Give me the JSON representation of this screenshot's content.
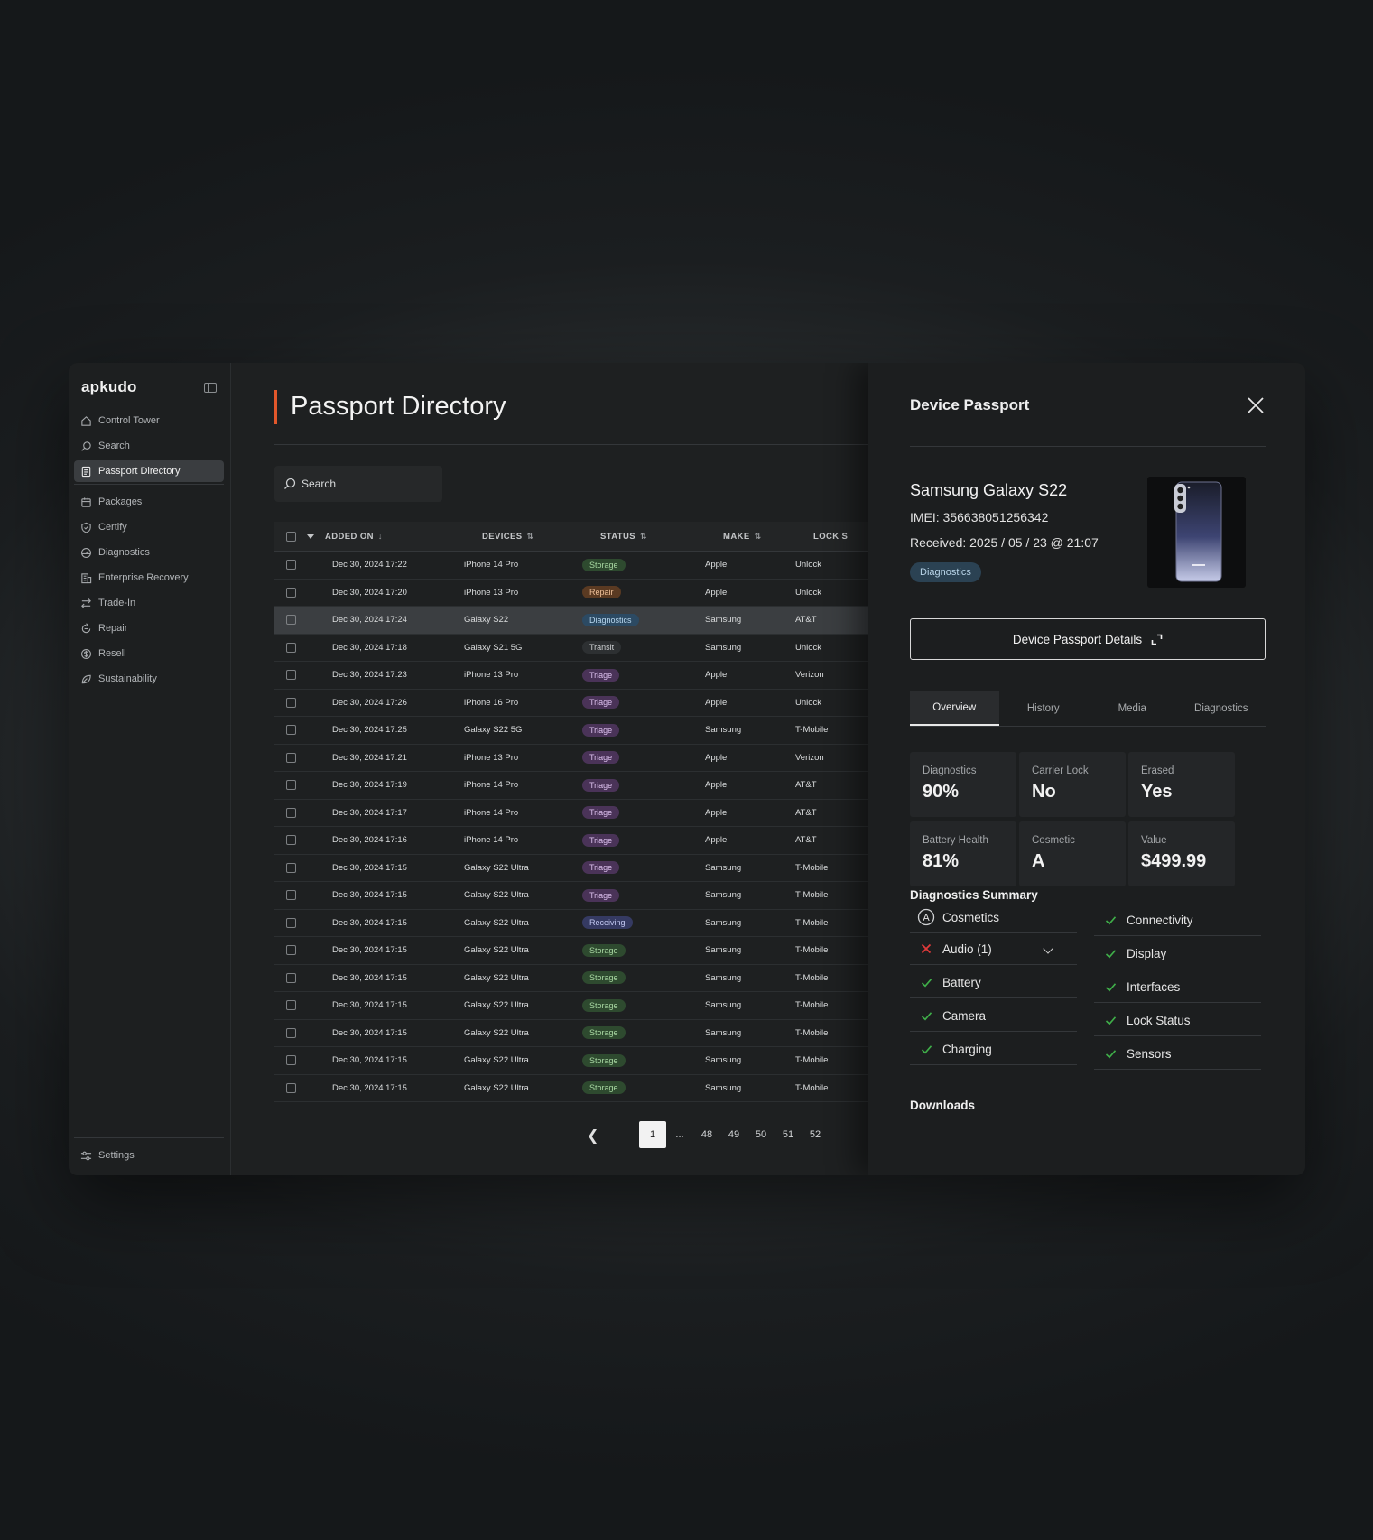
{
  "app": {
    "logo": "apkudo"
  },
  "sidebar": {
    "items": [
      {
        "label": "Control Tower",
        "icon": "home-icon"
      },
      {
        "label": "Search",
        "icon": "search-icon"
      },
      {
        "label": "Passport Directory",
        "icon": "document-icon",
        "active": true
      },
      {
        "label": "Packages",
        "icon": "package-icon"
      },
      {
        "label": "Certify",
        "icon": "shield-check-icon"
      },
      {
        "label": "Diagnostics",
        "icon": "gauge-icon"
      },
      {
        "label": "Enterprise Recovery",
        "icon": "building-icon"
      },
      {
        "label": "Trade-In",
        "icon": "swap-icon"
      },
      {
        "label": "Repair",
        "icon": "repair-icon"
      },
      {
        "label": "Resell",
        "icon": "dollar-circle-icon"
      },
      {
        "label": "Sustainability",
        "icon": "leaf-icon"
      }
    ],
    "settings_label": "Settings"
  },
  "main": {
    "title": "Passport Directory",
    "search_label": "Search",
    "table": {
      "headers": {
        "added_on": "ADDED ON",
        "devices": "DEVICES",
        "status": "STATUS",
        "make": "MAKE",
        "lock": "LOCK S"
      },
      "rows": [
        {
          "date": "Dec 30, 2024 17:22",
          "device": "iPhone 14 Pro",
          "status": "Storage",
          "make": "Apple",
          "lock": "Unlock"
        },
        {
          "date": "Dec 30, 2024 17:20",
          "device": "iPhone 13 Pro",
          "status": "Repair",
          "make": "Apple",
          "lock": "Unlock"
        },
        {
          "date": "Dec 30, 2024 17:24",
          "device": "Galaxy S22",
          "status": "Diagnostics",
          "make": "Samsung",
          "lock": "AT&T",
          "selected": true
        },
        {
          "date": "Dec 30, 2024 17:18",
          "device": "Galaxy S21 5G",
          "status": "Transit",
          "make": "Samsung",
          "lock": "Unlock"
        },
        {
          "date": "Dec 30, 2024 17:23",
          "device": "iPhone 13 Pro",
          "status": "Triage",
          "make": "Apple",
          "lock": "Verizon"
        },
        {
          "date": "Dec 30, 2024 17:26",
          "device": "iPhone 16 Pro",
          "status": "Triage",
          "make": "Apple",
          "lock": "Unlock"
        },
        {
          "date": "Dec 30, 2024 17:25",
          "device": "Galaxy S22 5G",
          "status": "Triage",
          "make": "Samsung",
          "lock": "T-Mobile"
        },
        {
          "date": "Dec 30, 2024 17:21",
          "device": "iPhone 13 Pro",
          "status": "Triage",
          "make": "Apple",
          "lock": "Verizon"
        },
        {
          "date": "Dec 30, 2024 17:19",
          "device": "iPhone 14 Pro",
          "status": "Triage",
          "make": "Apple",
          "lock": "AT&T"
        },
        {
          "date": "Dec 30, 2024 17:17",
          "device": "iPhone 14 Pro",
          "status": "Triage",
          "make": "Apple",
          "lock": "AT&T"
        },
        {
          "date": "Dec 30, 2024 17:16",
          "device": "iPhone 14 Pro",
          "status": "Triage",
          "make": "Apple",
          "lock": "AT&T"
        },
        {
          "date": "Dec 30, 2024 17:15",
          "device": "Galaxy S22 Ultra",
          "status": "Triage",
          "make": "Samsung",
          "lock": "T-Mobile"
        },
        {
          "date": "Dec 30, 2024 17:15",
          "device": "Galaxy S22 Ultra",
          "status": "Triage",
          "make": "Samsung",
          "lock": "T-Mobile"
        },
        {
          "date": "Dec 30, 2024 17:15",
          "device": "Galaxy S22 Ultra",
          "status": "Receiving",
          "make": "Samsung",
          "lock": "T-Mobile"
        },
        {
          "date": "Dec 30, 2024 17:15",
          "device": "Galaxy S22 Ultra",
          "status": "Storage",
          "make": "Samsung",
          "lock": "T-Mobile"
        },
        {
          "date": "Dec 30, 2024 17:15",
          "device": "Galaxy S22 Ultra",
          "status": "Storage",
          "make": "Samsung",
          "lock": "T-Mobile"
        },
        {
          "date": "Dec 30, 2024 17:15",
          "device": "Galaxy S22 Ultra",
          "status": "Storage",
          "make": "Samsung",
          "lock": "T-Mobile"
        },
        {
          "date": "Dec 30, 2024 17:15",
          "device": "Galaxy S22 Ultra",
          "status": "Storage",
          "make": "Samsung",
          "lock": "T-Mobile"
        },
        {
          "date": "Dec 30, 2024 17:15",
          "device": "Galaxy S22 Ultra",
          "status": "Storage",
          "make": "Samsung",
          "lock": "T-Mobile"
        },
        {
          "date": "Dec 30, 2024 17:15",
          "device": "Galaxy S22 Ultra",
          "status": "Storage",
          "make": "Samsung",
          "lock": "T-Mobile"
        }
      ]
    },
    "status_colors": {
      "Storage": {
        "bg": "#2e4a2f",
        "fg": "#a9d9a3"
      },
      "Repair": {
        "bg": "#5a3a22",
        "fg": "#f0c29a"
      },
      "Diagnostics": {
        "bg": "#2c4a63",
        "fg": "#b9d8f0"
      },
      "Transit": {
        "bg": "#2d3032",
        "fg": "#d0d2d4"
      },
      "Triage": {
        "bg": "#4a3358",
        "fg": "#dcc0ee"
      },
      "Receiving": {
        "bg": "#353a62",
        "fg": "#c3c9f2"
      }
    },
    "pagination": {
      "pages": [
        "1",
        "...",
        "48",
        "49",
        "50",
        "51",
        "52"
      ],
      "current": "1"
    }
  },
  "panel": {
    "title": "Device Passport",
    "device_name": "Samsung Galaxy S22",
    "imei": "IMEI: 356638051256342",
    "received": "Received: 2025 / 05 / 23 @ 21:07",
    "status_badge": "Diagnostics",
    "details_button": "Device Passport Details",
    "tabs": [
      "Overview",
      "History",
      "Media",
      "Diagnostics"
    ],
    "active_tab": "Overview",
    "stats": [
      {
        "label": "Diagnostics",
        "value": "90%"
      },
      {
        "label": "Carrier Lock",
        "value": "No"
      },
      {
        "label": "Erased",
        "value": "Yes"
      },
      {
        "label": "Battery Health",
        "value": "81%"
      },
      {
        "label": "Cosmetic",
        "value": "A"
      },
      {
        "label": "Value",
        "value": "$499.99"
      }
    ],
    "diagnostics_summary_title": "Diagnostics Summary",
    "diagnostics_left": [
      {
        "label": "Cosmetics",
        "state": "grade"
      },
      {
        "label": "Audio (1)",
        "state": "fail"
      },
      {
        "label": "Battery",
        "state": "pass"
      },
      {
        "label": "Camera",
        "state": "pass"
      },
      {
        "label": "Charging",
        "state": "pass"
      }
    ],
    "diagnostics_right": [
      {
        "label": "Connectivity",
        "state": "pass"
      },
      {
        "label": "Display",
        "state": "pass"
      },
      {
        "label": "Interfaces",
        "state": "pass"
      },
      {
        "label": "Lock Status",
        "state": "pass"
      },
      {
        "label": "Sensors",
        "state": "pass"
      }
    ],
    "cosmetic_grade_glyph": "A",
    "downloads_title": "Downloads"
  },
  "colors": {
    "accent": "#e2572b",
    "pass": "#3fae49",
    "fail": "#e03a3a"
  }
}
